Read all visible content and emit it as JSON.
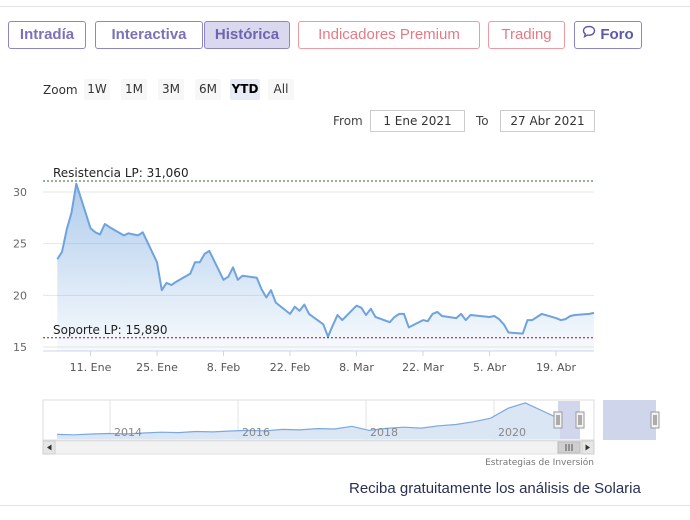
{
  "tabs": [
    {
      "label": "Intradía",
      "style": "purple"
    },
    {
      "label": "Interactiva",
      "style": "purple"
    },
    {
      "label": "Histórica",
      "style": "active"
    },
    {
      "label": "Indicadores Premium",
      "style": "pink"
    },
    {
      "label": "Trading",
      "style": "pink"
    },
    {
      "label": "Foro",
      "style": "foro",
      "icon": "chat-bubble-icon"
    }
  ],
  "zoom": {
    "label": "Zoom",
    "buttons": [
      "1W",
      "1M",
      "3M",
      "6M",
      "YTD",
      "All"
    ],
    "selected": "YTD"
  },
  "range": {
    "from_label": "From",
    "from_value": "1 Ene 2021",
    "to_label": "To",
    "to_value": "27 Abr 2021"
  },
  "chart_data": {
    "type": "area",
    "x_start": "2021-01-01",
    "x_end": "2021-04-27",
    "x": [
      "2021-01-04",
      "2021-01-05",
      "2021-01-06",
      "2021-01-07",
      "2021-01-08",
      "2021-01-11",
      "2021-01-12",
      "2021-01-13",
      "2021-01-14",
      "2021-01-15",
      "2021-01-18",
      "2021-01-19",
      "2021-01-20",
      "2021-01-21",
      "2021-01-22",
      "2021-01-25",
      "2021-01-26",
      "2021-01-27",
      "2021-01-28",
      "2021-01-29",
      "2021-02-01",
      "2021-02-02",
      "2021-02-03",
      "2021-02-04",
      "2021-02-05",
      "2021-02-08",
      "2021-02-09",
      "2021-02-10",
      "2021-02-11",
      "2021-02-12",
      "2021-02-15",
      "2021-02-16",
      "2021-02-17",
      "2021-02-18",
      "2021-02-19",
      "2021-02-22",
      "2021-02-23",
      "2021-02-24",
      "2021-02-25",
      "2021-02-26",
      "2021-03-01",
      "2021-03-02",
      "2021-03-03",
      "2021-03-04",
      "2021-03-05",
      "2021-03-08",
      "2021-03-09",
      "2021-03-10",
      "2021-03-11",
      "2021-03-12",
      "2021-03-15",
      "2021-03-16",
      "2021-03-17",
      "2021-03-18",
      "2021-03-19",
      "2021-03-22",
      "2021-03-23",
      "2021-03-24",
      "2021-03-25",
      "2021-03-26",
      "2021-03-29",
      "2021-03-30",
      "2021-03-31",
      "2021-04-01",
      "2021-04-05",
      "2021-04-06",
      "2021-04-07",
      "2021-04-08",
      "2021-04-09",
      "2021-04-12",
      "2021-04-13",
      "2021-04-14",
      "2021-04-15",
      "2021-04-16",
      "2021-04-19",
      "2021-04-20",
      "2021-04-21",
      "2021-04-22",
      "2021-04-23",
      "2021-04-26",
      "2021-04-27"
    ],
    "values": [
      23.5,
      24.2,
      26.4,
      28.0,
      30.8,
      26.5,
      26.1,
      25.9,
      26.9,
      26.6,
      25.8,
      26.0,
      25.9,
      25.8,
      26.1,
      23.2,
      20.5,
      21.2,
      21.0,
      21.3,
      22.1,
      23.2,
      23.2,
      24.0,
      24.3,
      21.5,
      21.8,
      22.7,
      21.5,
      21.9,
      21.7,
      20.6,
      19.8,
      20.5,
      19.3,
      18.2,
      18.9,
      18.5,
      19.1,
      18.2,
      17.2,
      16.0,
      17.1,
      18.1,
      17.6,
      19.0,
      18.8,
      18.1,
      18.7,
      17.9,
      17.4,
      17.9,
      18.2,
      18.2,
      16.9,
      17.6,
      17.5,
      18.2,
      18.4,
      18.0,
      17.8,
      18.2,
      17.6,
      18.1,
      17.9,
      18.0,
      17.7,
      17.2,
      16.4,
      16.3,
      17.6,
      17.6,
      17.9,
      18.2,
      17.8,
      17.6,
      17.7,
      18.0,
      18.1,
      18.2,
      18.3
    ],
    "ylim": [
      14.5,
      31.5
    ],
    "yticks": [
      "30",
      "25",
      "20",
      "15"
    ],
    "xticks": [
      "11. Ene",
      "25. Ene",
      "8. Feb",
      "22. Feb",
      "8. Mar",
      "22. Mar",
      "5. Abr",
      "19. Abr"
    ],
    "annotations": [
      {
        "label": "Resistencia LP: 31,060",
        "value": 31.06,
        "color": "#1f6f1f"
      },
      {
        "label": "Soporte LP: 15,890",
        "value": 15.89,
        "color": "#8b1a1a"
      }
    ],
    "grid": true
  },
  "navigator": {
    "year_labels": [
      "2014",
      "2016",
      "2018",
      "2020"
    ],
    "credit": "Estrategias de Inversión",
    "series": [
      14.0,
      13.8,
      14.2,
      14.5,
      14.3,
      14.8,
      15.2,
      15.0,
      15.6,
      15.4,
      15.9,
      16.2,
      16.0,
      16.8,
      16.5,
      17.2,
      17.0,
      18.5,
      16.2,
      17.4,
      18.0,
      17.5,
      18.8,
      19.5,
      21.0,
      23.0,
      28.5,
      31.5,
      27.0,
      22.5
    ]
  },
  "footer": {
    "text": "Reciba gratuitamente los análisis de Solaria"
  },
  "colors": {
    "line": "#6ea3dd",
    "accent": "#8f87c4",
    "pink": "#e47a86"
  }
}
